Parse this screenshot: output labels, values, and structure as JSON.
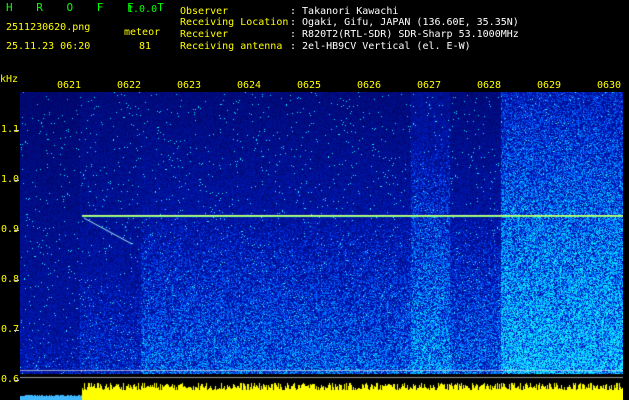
{
  "header": {
    "app_name": "H R O F F T",
    "version": "1.0.0",
    "filename": "2511230620.png",
    "detection_type": "meteor",
    "datetime": "25.11.23 06:20",
    "count": "81",
    "observer_label": "Observer",
    "observer_value": ": Takanori Kawachi",
    "location_label": "Receiving Location",
    "location_value": ": Ogaki, Gifu, JAPAN (136.60E, 35.35N)",
    "receiver_label": "Receiver",
    "receiver_value": ": R820T2(RTL-SDR) SDR-Sharp 53.1000MHz",
    "antenna_label": "Receiving antenna",
    "antenna_value": ": 2el-HB9CV Vertical (el. E-W)"
  },
  "axis": {
    "y_unit": "kHz",
    "y_ticks": [
      "1.1",
      "1.0",
      "0.9",
      "0.8",
      "0.7",
      "0.6"
    ],
    "x_ticks": [
      "0621",
      "0622",
      "0623",
      "0624",
      "0625",
      "0626",
      "0627",
      "0628",
      "0629",
      "0630"
    ]
  },
  "colors": {
    "background": "#000000",
    "waterfall_low": "#00008a",
    "waterfall_high": "#00ffff",
    "carrier_line": "#7fff7f",
    "level_bar": "#ffff00",
    "level_bar_pre": "#3fb8ff",
    "header_green": "#00ff00",
    "header_yellow": "#ffff00"
  }
}
